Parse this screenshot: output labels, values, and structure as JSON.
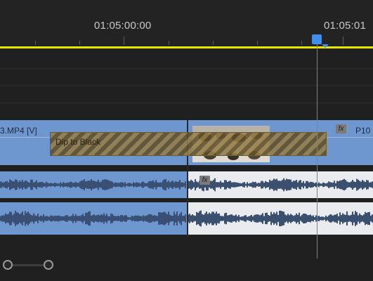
{
  "ruler": {
    "timecodes": [
      "01:05:00:00",
      "01:05:01"
    ]
  },
  "tracks": {
    "video1": {
      "clip_a_label": "3.MP4 [V]",
      "clip_b_label": "P10",
      "transition_label": "Dip to Black",
      "fx_icon_label": "fx"
    },
    "audio1": {
      "fx_icon_label": "fx"
    }
  },
  "colors": {
    "playhead": "#3f8ff0",
    "work_area_bar": "#e6e600",
    "selected_clip": "#6e97cf",
    "unselected_clip": "#cfd3d8"
  },
  "icons": [
    "playhead-icon",
    "fx-icon",
    "scroll-handle-icon"
  ]
}
